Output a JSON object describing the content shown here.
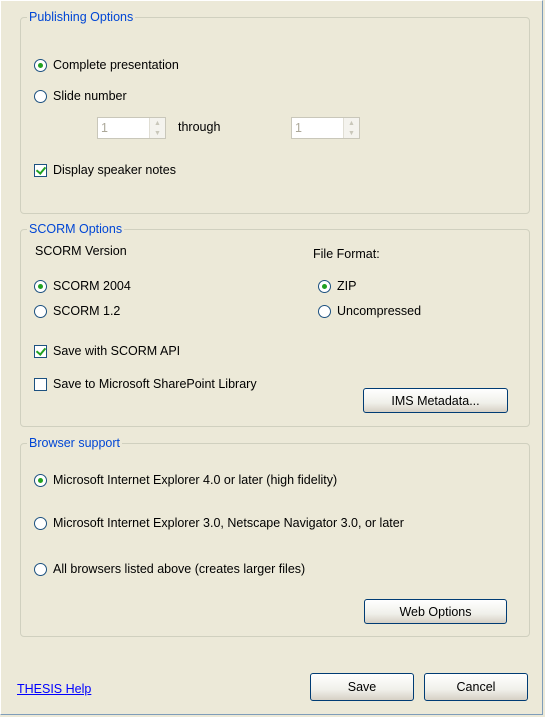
{
  "publishing": {
    "title": "Publishing Options",
    "complete_label": "Complete presentation",
    "slide_label": "Slide number",
    "from_value": "1",
    "through_label": "through",
    "to_value": "1",
    "speaker_notes_label": "Display speaker notes"
  },
  "scorm": {
    "title": "SCORM Options",
    "version_label": "SCORM Version",
    "v2004_label": "SCORM 2004",
    "v12_label": "SCORM 1.2",
    "format_label": "File Format:",
    "zip_label": "ZIP",
    "uncompressed_label": "Uncompressed",
    "api_label": "Save with SCORM API",
    "sharepoint_label": "Save to Microsoft SharePoint Library",
    "metadata_button": "IMS Metadata..."
  },
  "browser": {
    "title": "Browser support",
    "ie4_label": "Microsoft Internet Explorer 4.0 or later (high fidelity)",
    "ie3_label": "Microsoft Internet Explorer 3.0, Netscape Navigator 3.0, or later",
    "all_label": "All browsers listed above (creates larger files)",
    "web_options_button": "Web Options"
  },
  "footer": {
    "help_link": "THESIS Help",
    "save_button": "Save",
    "cancel_button": "Cancel"
  }
}
